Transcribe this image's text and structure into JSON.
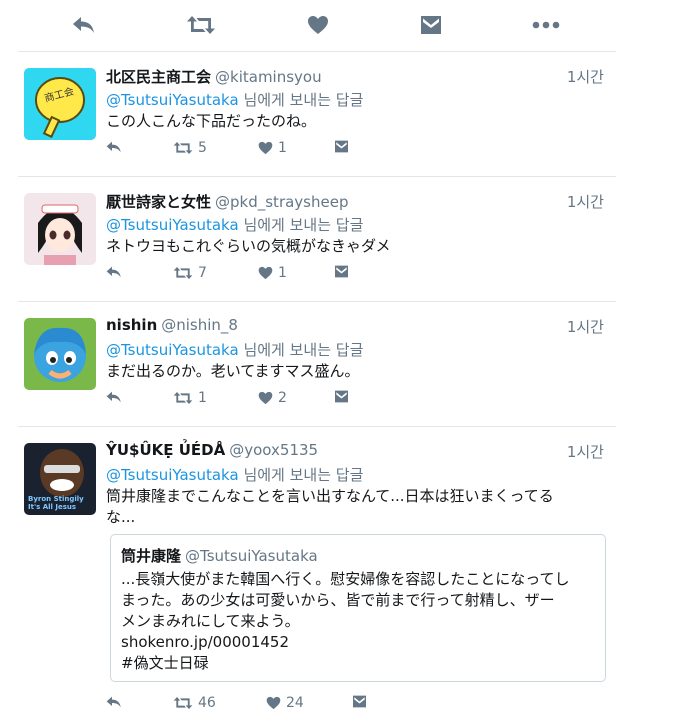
{
  "top_actions": [
    "reply-icon",
    "retweet-icon",
    "like-icon",
    "dm-icon",
    "more-icon"
  ],
  "reply_prefix_suffix": "님에게 보내는 답글",
  "tweets": [
    {
      "name": "北区民主商工会",
      "handle": "@kitaminsyou",
      "time": "1시간",
      "reply_to": "@TsutsuiYasutaka",
      "reply_suffix": "님에게 보내는 답글",
      "text": "この人こんな下品だったのね。",
      "retweets": "5",
      "likes": "1"
    },
    {
      "name": "厭世詩家と女性",
      "handle": "@pkd_straysheep",
      "time": "1시간",
      "reply_to": "@TsutsuiYasutaka",
      "reply_suffix": "님에게 보내는 답글",
      "text": "ネトウヨもこれぐらいの気概がなきゃダメ",
      "retweets": "7",
      "likes": "1"
    },
    {
      "name": "nishin",
      "handle": "@nishin_8",
      "time": "1시간",
      "reply_to": "@TsutsuiYasutaka",
      "reply_suffix": "님에게 보내는 답글",
      "text": "まだ出るのか。老いてますマス盛ん。",
      "retweets": "1",
      "likes": "2"
    },
    {
      "name": "ŶU$ÛKẸ ỦÉDÅ",
      "handle": "@yoox5135",
      "time": "1시간",
      "reply_to": "@TsutsuiYasutaka",
      "reply_suffix": "님에게 보내는 답글",
      "text_line1": "筒井康隆までこんなことを言い出すなんて...日本は狂いまくってる",
      "text_line2": "な...",
      "retweets": "46",
      "likes": "24",
      "quote": {
        "name": "筒井康隆",
        "handle": "@TsutsuiYasutaka",
        "line1": "...長嶺大使がまた韓国へ行く。慰安婦像を容認したことになってし",
        "line2": "まった。あの少女は可愛いから、皆で前まで行って射精し、ザー",
        "line3": "メンまみれにして来よう。",
        "line4": "shokenro.jp/00001452",
        "line5": "#偽文士日碌"
      },
      "avatar_text1": "Byron Stingily",
      "avatar_text2": "It's All Jesus"
    }
  ],
  "avatar1_text": "商工会"
}
